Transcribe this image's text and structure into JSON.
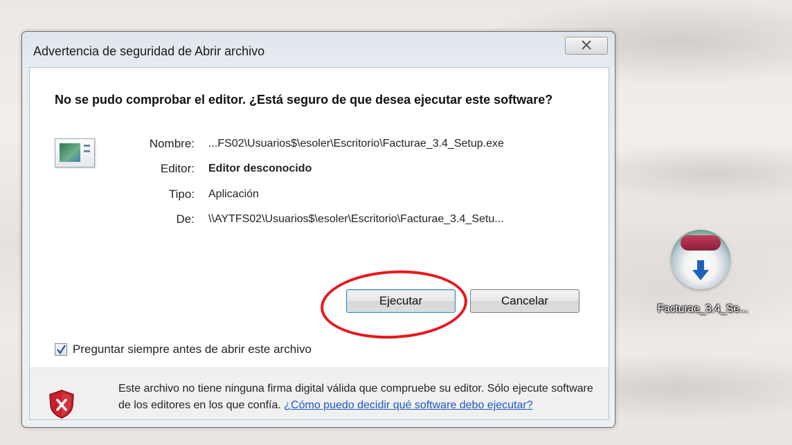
{
  "dialog": {
    "title": "Advertencia de seguridad de Abrir archivo",
    "heading": "No se pudo comprobar el editor. ¿Está seguro de que desea ejecutar este software?",
    "fields": {
      "nombre_label": "Nombre:",
      "nombre_value": "...FS02\\Usuarios$\\esoler\\Escritorio\\Facturae_3.4_Setup.exe",
      "editor_label": "Editor:",
      "editor_value": "Editor desconocido",
      "tipo_label": "Tipo:",
      "tipo_value": "Aplicación",
      "de_label": "De:",
      "de_value": "\\\\AYTFS02\\Usuarios$\\esoler\\Escritorio\\Facturae_3.4_Setu..."
    },
    "buttons": {
      "run_label": "Ejecutar",
      "cancel_label": "Cancelar"
    },
    "checkbox": {
      "label": "Preguntar siempre antes de abrir este archivo",
      "checked": true
    },
    "footer": {
      "text": "Este archivo no tiene ninguna firma digital válida que compruebe su editor. Sólo ejecute software de los editores en los que confía.",
      "link": "¿Cómo puedo decidir qué software debo ejecutar?"
    },
    "icons": {
      "close": "close-icon",
      "file": "application-file-icon",
      "shield": "shield-error-icon"
    }
  },
  "desktop": {
    "icon_label": "Facturae_3.4_Se...",
    "icon_name": "setup-disc-icon"
  },
  "colors": {
    "annotation_ring": "#e8161c",
    "link": "#1c56c6",
    "shield": "#c8202a"
  }
}
